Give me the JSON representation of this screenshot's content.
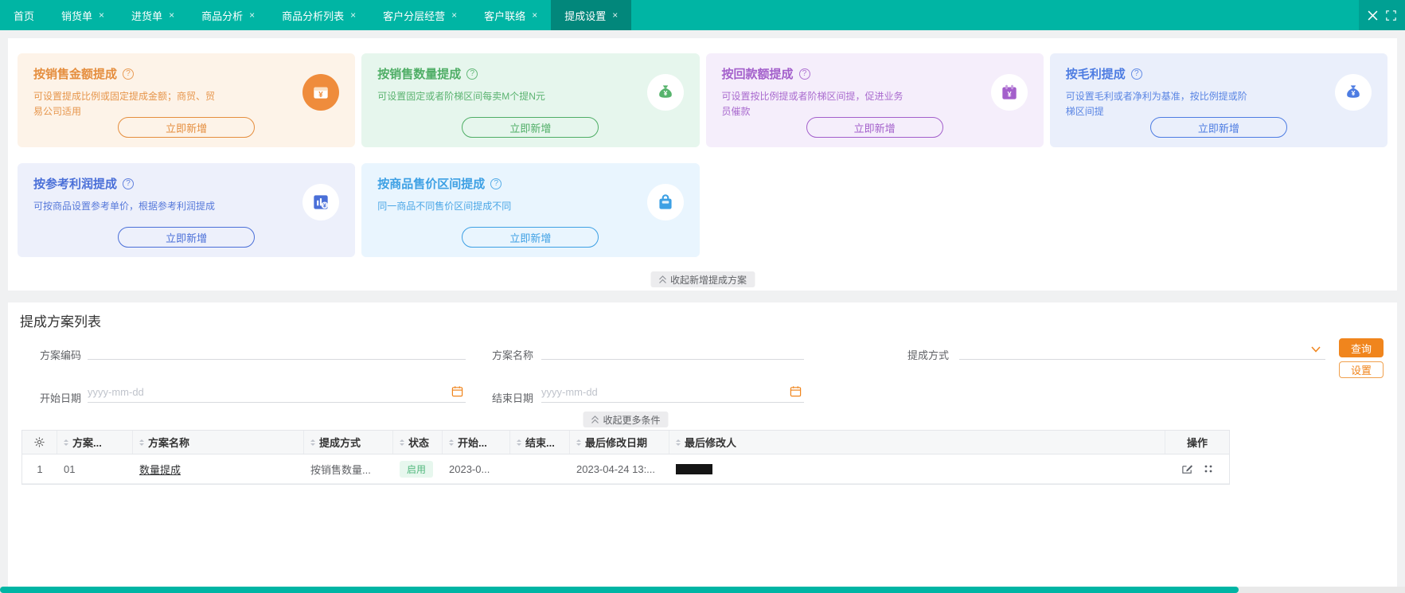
{
  "colors": {
    "topbar": "#00b5a4",
    "topbar_active_tab": "#02877b",
    "primary_orange": "#f0851d",
    "status_enabled_bg": "#e7f7ee",
    "status_enabled_text": "#52b87e",
    "card_orange": "#e58e3e",
    "card_green": "#4fae66",
    "card_purple": "#a35fcb",
    "card_blue": "#4d7ce2",
    "card_indigo": "#4a6fd8",
    "card_sky": "#3da0e4",
    "scrollbar_thumb": "#00b5a4"
  },
  "tabbar": {
    "close_symbol": "×",
    "tabs": [
      {
        "label": "首页",
        "closable": false
      },
      {
        "label": "销货单",
        "closable": true
      },
      {
        "label": "进货单",
        "closable": true
      },
      {
        "label": "商品分析",
        "closable": true
      },
      {
        "label": "商品分析列表",
        "closable": true
      },
      {
        "label": "客户分层经营",
        "closable": true
      },
      {
        "label": "客户联络",
        "closable": true
      },
      {
        "label": "提成设置",
        "closable": true,
        "active": true
      }
    ],
    "window_icons": [
      "close-icon",
      "fullscreen-icon"
    ]
  },
  "cards": [
    {
      "title": "按销售金额提成",
      "desc": "可设置提成比例或固定提成金额；商贸、贸易公司适用",
      "button": "立即新增",
      "icon": "wallet-icon",
      "theme": "orange"
    },
    {
      "title": "按销售数量提成",
      "desc": "可设置固定或者阶梯区间每卖M个提N元",
      "button": "立即新增",
      "icon": "money-pouch-icon",
      "theme": "green"
    },
    {
      "title": "按回款额提成",
      "desc": "可设置按比例提或者阶梯区间提，促进业务员催款",
      "button": "立即新增",
      "icon": "calendar-yuan-icon",
      "theme": "purple"
    },
    {
      "title": "按毛利提成",
      "desc": "可设置毛利或者净利为基准，按比例提或阶梯区间提",
      "button": "立即新增",
      "icon": "money-bag-icon",
      "theme": "blue"
    },
    {
      "title": "按参考利润提成",
      "desc": "可按商品设置参考单价，根据参考利润提成",
      "button": "立即新增",
      "icon": "chart-coin-icon",
      "theme": "indigo"
    },
    {
      "title": "按商品售价区间提成",
      "desc": "同一商品不同售价区间提成不同",
      "button": "立即新增",
      "icon": "shopping-bag-icon",
      "theme": "sky"
    }
  ],
  "cards_collapse": {
    "label": "收起新增提成方案",
    "icon": "double-chevron-up-icon"
  },
  "list_section": {
    "title": "提成方案列表",
    "filters": {
      "code_label": "方案编码",
      "name_label": "方案名称",
      "method_label": "提成方式",
      "start_label": "开始日期",
      "end_label": "结束日期",
      "date_placeholder": "yyyy-mm-dd",
      "search_button": "查询",
      "settings_button": "设置",
      "collapse": {
        "label": "收起更多条件",
        "icon": "double-chevron-up-icon"
      }
    }
  },
  "table": {
    "headers": {
      "settings": "",
      "code": "方案...",
      "name": "方案名称",
      "method": "提成方式",
      "status": "状态",
      "start": "开始...",
      "end": "结束...",
      "modified_date": "最后修改日期",
      "modified_by": "最后修改人",
      "actions": "操作"
    },
    "rows": [
      {
        "index": "1",
        "code": "01",
        "name": "数量提成",
        "method": "按销售数量...",
        "status": "启用",
        "start": "2023-0...",
        "end": "",
        "modified_date": "2023-04-24 13:...",
        "modified_by": "",
        "modified_by_redacted": true,
        "action_icons": [
          "edit-icon",
          "more-grid-icon"
        ]
      }
    ]
  }
}
